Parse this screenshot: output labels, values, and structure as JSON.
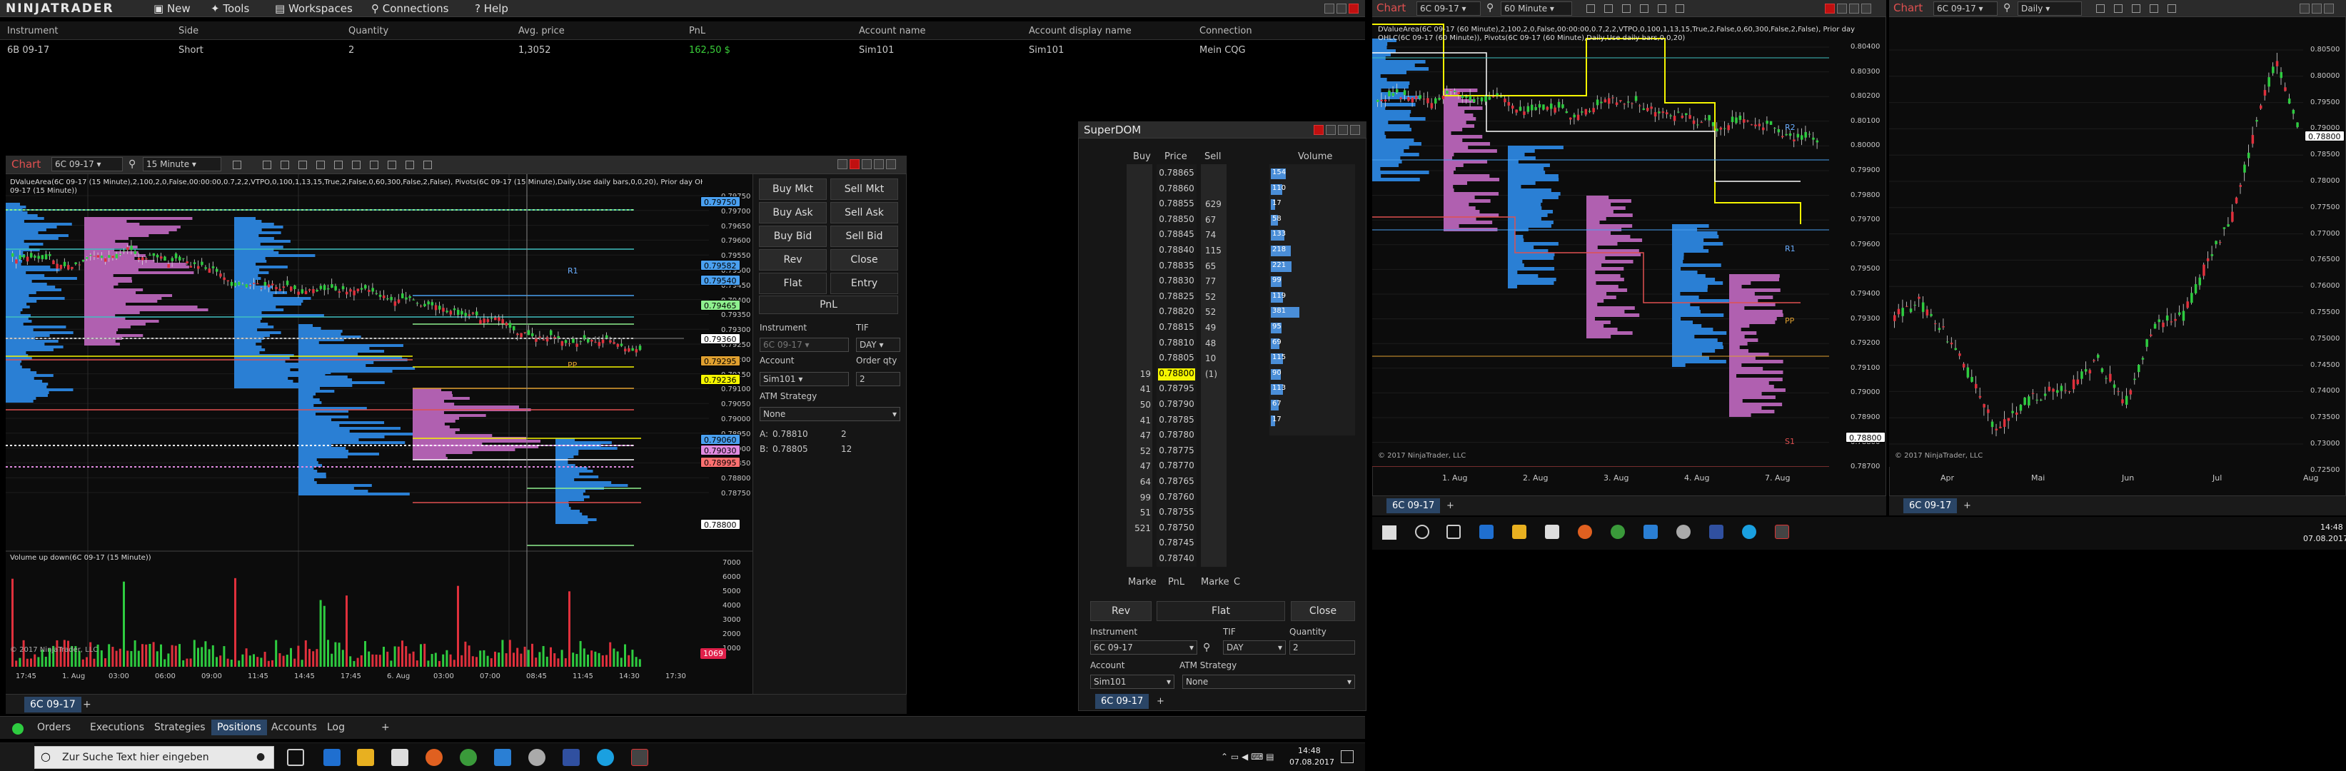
{
  "app": {
    "logo": "NINJATRADER"
  },
  "menu": {
    "new": "New",
    "tools": "Tools",
    "workspaces": "Workspaces",
    "connections": "Connections",
    "help": "Help"
  },
  "positions": {
    "headers": [
      "Instrument",
      "Side",
      "Quantity",
      "Avg. price",
      "PnL",
      "Account name",
      "Account display name",
      "Connection"
    ],
    "row": {
      "instrument": "6B 09-17",
      "side": "Short",
      "quantity": "2",
      "avg_price": "1,3052",
      "pnl": "162,50 $",
      "account": "Sim101",
      "display": "Sim101",
      "connection": "Mein CQG"
    }
  },
  "chart1": {
    "title": "Chart",
    "instrument": "6C 09-17",
    "interval": "15 Minute",
    "info": "DValueArea(6C 09-17 (15 Minute),2,100,2,0,False,00:00:00,0.7,2,2,VTPO,0,100,1,13,15,True,2,False,0,60,300,False,2,False), Pivots(6C 09-17 (15 Minute),Daily,Use daily bars,0,0,20), Prior day OHLC(6C",
    "info2": "09-17 (15 Minute))",
    "sub_title": "Volume up down(6C 09-17 (15 Minute))",
    "copyright": "© 2017 NinjaTrader, LLC",
    "price_axis": [
      "0.79750",
      "0.79700",
      "0.79650",
      "0.79600",
      "0.79550",
      "0.79500",
      "0.79450",
      "0.79400",
      "0.79350",
      "0.79300",
      "0.79250",
      "0.79200",
      "0.79150",
      "0.79100",
      "0.79050",
      "0.79000",
      "0.78950",
      "0.78900",
      "0.78850",
      "0.78800",
      "0.78750"
    ],
    "vol_axis": [
      "7000",
      "6000",
      "5000",
      "4000",
      "3000",
      "2000",
      "1000"
    ],
    "time_axis": [
      "17:45",
      "1. Aug",
      "03:00",
      "06:00",
      "09:00",
      "11:45",
      "14:45",
      "17:45",
      "6. Aug",
      "03:00",
      "07:00",
      "08:45",
      "11:45",
      "14:30",
      "17:30"
    ],
    "tags": {
      "t1": "0.79750",
      "t2": "0.79582",
      "t3": "0.79540",
      "t4": "0.79465",
      "t5": "0.79360",
      "t6": "0.79295",
      "t7": "0.79236",
      "t8": "0.79060",
      "t9": "0.79030",
      "t10": "0.78995",
      "last": "0.78800",
      "vol": "1069"
    },
    "pivots": {
      "r1": "R1",
      "pp": "PP"
    },
    "tab": "6C 09-17"
  },
  "order_panel": {
    "buy_mkt": "Buy Mkt",
    "sell_mkt": "Sell Mkt",
    "buy_ask": "Buy Ask",
    "sell_ask": "Sell Ask",
    "buy_bid": "Buy Bid",
    "sell_bid": "Sell Bid",
    "rev": "Rev",
    "close": "Close",
    "flat": "Flat",
    "entry": "Entry",
    "pnl": "PnL",
    "instrument_label": "Instrument",
    "instrument_value": "6C 09-17",
    "tif_label": "TIF",
    "tif_value": "DAY",
    "account_label": "Account",
    "account_value": "Sim101",
    "qty_label": "Order qty",
    "qty_value": "2",
    "atm_label": "ATM Strategy",
    "atm_value": "None",
    "a_label": "A:",
    "a_price": "0.78810",
    "a_qty": "2",
    "b_label": "B:",
    "b_price": "0.78805",
    "b_qty": "12"
  },
  "superdom": {
    "title": "SuperDOM",
    "headers": {
      "buy": "Buy",
      "price": "Price",
      "sell": "Sell",
      "volume": "Volume"
    },
    "rows": [
      {
        "buy": "",
        "price": "0.78865",
        "sell": "",
        "vol": "154"
      },
      {
        "buy": "",
        "price": "0.78860",
        "sell": "",
        "vol": "110"
      },
      {
        "buy": "",
        "price": "0.78855",
        "sell": "629",
        "vol": "17"
      },
      {
        "buy": "",
        "price": "0.78850",
        "sell": "67",
        "vol": "58"
      },
      {
        "buy": "",
        "price": "0.78845",
        "sell": "74",
        "vol": "133"
      },
      {
        "buy": "",
        "price": "0.78840",
        "sell": "115",
        "vol": "218"
      },
      {
        "buy": "",
        "price": "0.78835",
        "sell": "65",
        "vol": "221"
      },
      {
        "buy": "",
        "price": "0.78830",
        "sell": "77",
        "vol": "99"
      },
      {
        "buy": "",
        "price": "0.78825",
        "sell": "52",
        "vol": "119"
      },
      {
        "buy": "",
        "price": "0.78820",
        "sell": "52",
        "vol": "381"
      },
      {
        "buy": "",
        "price": "0.78815",
        "sell": "49",
        "vol": "95"
      },
      {
        "buy": "",
        "price": "0.78810",
        "sell": "48",
        "vol": "69"
      },
      {
        "buy": "",
        "price": "0.78805",
        "sell": "10",
        "vol": "115"
      },
      {
        "buy": "19",
        "price": "0.78800",
        "sell": "(1)",
        "vol": "90"
      },
      {
        "buy": "41",
        "price": "0.78795",
        "sell": "",
        "vol": "113"
      },
      {
        "buy": "50",
        "price": "0.78790",
        "sell": "",
        "vol": "67"
      },
      {
        "buy": "41",
        "price": "0.78785",
        "sell": "",
        "vol": "17"
      },
      {
        "buy": "47",
        "price": "0.78780",
        "sell": "",
        "vol": ""
      },
      {
        "buy": "52",
        "price": "0.78775",
        "sell": "",
        "vol": ""
      },
      {
        "buy": "47",
        "price": "0.78770",
        "sell": "",
        "vol": ""
      },
      {
        "buy": "64",
        "price": "0.78765",
        "sell": "",
        "vol": ""
      },
      {
        "buy": "99",
        "price": "0.78760",
        "sell": "",
        "vol": ""
      },
      {
        "buy": "51",
        "price": "0.78755",
        "sell": "",
        "vol": ""
      },
      {
        "buy": "521",
        "price": "0.78750",
        "sell": "",
        "vol": ""
      },
      {
        "buy": "",
        "price": "0.78745",
        "sell": "",
        "vol": ""
      },
      {
        "buy": "",
        "price": "0.78740",
        "sell": "",
        "vol": ""
      }
    ],
    "foot": {
      "market_l": "Marke",
      "pnl": "PnL",
      "market_r": "Marke",
      "c": "C"
    },
    "rev": "Rev",
    "flat": "Flat",
    "close": "Close",
    "instrument_label": "Instrument",
    "instrument_value": "6C 09-17",
    "tif_label": "TIF",
    "tif_value": "DAY",
    "qty_label": "Quantity",
    "qty_value": "2",
    "account_label": "Account",
    "account_value": "Sim101",
    "atm_label": "ATM Strategy",
    "atm_value": "None",
    "tab": "6C 09-17"
  },
  "chart2": {
    "title": "Chart",
    "instrument": "6C 09-17",
    "interval": "60 Minute",
    "info": "DValueArea(6C 09-17 (60 Minute),2,100,2,0,False,00:00:00,0.7,2,2,VTPO,0,100,1,13,15,True,2,False,0,60,300,False,2,False), Prior day",
    "info2": "OHLC(6C 09-17 (60 Minute)), Pivots(6C 09-17 (60 Minute),Daily,Use daily bars,0,0,20)",
    "copyright": "© 2017 NinjaTrader, LLC",
    "price_axis": [
      "0.80400",
      "0.80300",
      "0.80200",
      "0.80100",
      "0.80000",
      "0.79900",
      "0.79800",
      "0.79700",
      "0.79600",
      "0.79500",
      "0.79400",
      "0.79300",
      "0.79200",
      "0.79100",
      "0.79000",
      "0.78900",
      "0.78800",
      "0.78700"
    ],
    "time_axis": [
      "1. Aug",
      "2. Aug",
      "3. Aug",
      "4. Aug",
      "7. Aug"
    ],
    "last": "0.78800",
    "pivots": {
      "r2": "R2",
      "r1": "R1",
      "pp": "PP",
      "s1": "S1"
    },
    "tab": "6C 09-17"
  },
  "chart3": {
    "title": "Chart",
    "instrument": "6C 09-17",
    "interval": "Daily",
    "copyright": "© 2017 NinjaTrader, LLC",
    "price_axis": [
      "0.80500",
      "0.80000",
      "0.79500",
      "0.79000",
      "0.78500",
      "0.78000",
      "0.77500",
      "0.77000",
      "0.76500",
      "0.76000",
      "0.75500",
      "0.75000",
      "0.74500",
      "0.74000",
      "0.73500",
      "0.73000",
      "0.72500"
    ],
    "time_axis": [
      "Apr",
      "Mai",
      "Jun",
      "Jul",
      "Aug"
    ],
    "last": "0.78800",
    "tab": "6C 09-17"
  },
  "bottom_tabs": {
    "orders": "Orders",
    "executions": "Executions",
    "strategies": "Strategies",
    "positions": "Positions",
    "accounts": "Accounts",
    "log": "Log"
  },
  "taskbar": {
    "search": "Zur Suche Text hier eingeben",
    "time": "14:48",
    "date": "07.08.2017"
  },
  "colors": {
    "accent": "#2a4566",
    "bull": "#2ecc40",
    "bear": "#e0303c",
    "profile_blue": "#2a7fd4",
    "profile_pink": "#b060b0",
    "pivot_yellow": "#f5f500"
  }
}
